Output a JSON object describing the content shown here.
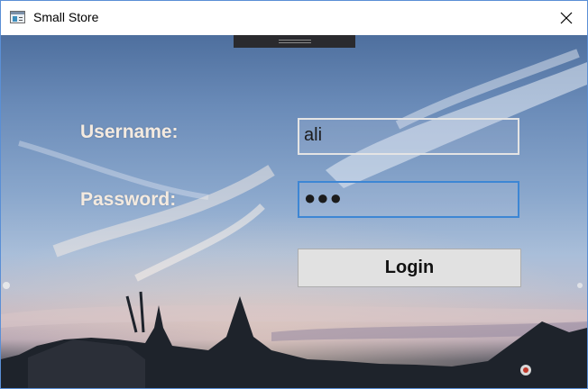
{
  "window": {
    "title": "Small Store"
  },
  "icons": {
    "app": "app-window-icon",
    "close": "close-icon",
    "handle": "drag-handle-icon"
  },
  "login_form": {
    "username_label": "Username:",
    "username_value": "ali",
    "password_label": "Password:",
    "password_value": "●●●",
    "login_label": "Login"
  },
  "colors": {
    "label_text": "#f4eadf",
    "focus_border": "#3d86d4",
    "button_bg": "#e1e1e1",
    "sky_top": "#4e6f9e"
  }
}
